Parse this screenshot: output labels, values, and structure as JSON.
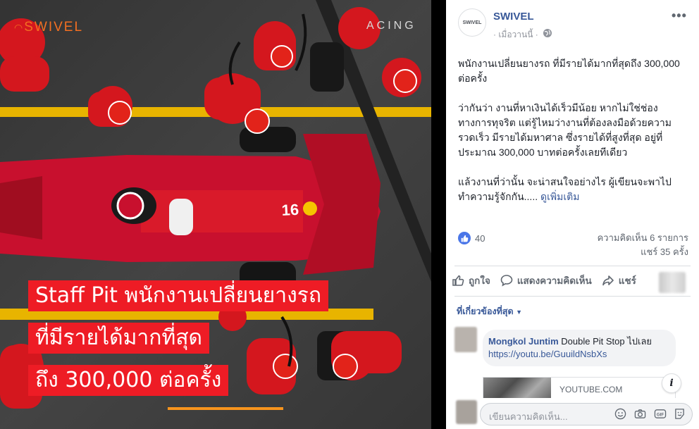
{
  "photo": {
    "brand_logo": "SWIVEL",
    "racing_text": "ACING",
    "car_number": "16",
    "headline": [
      "Staff Pit พนักงานเปลี่ยนยางรถ",
      "ที่มีรายได้มากที่สุด",
      "ถึง 300,000 ต่อครั้ง"
    ]
  },
  "post": {
    "avatar_text": "SWIVEL",
    "page_name": "SWIVEL",
    "time": "· เมื่อวานนี้ ·",
    "more_icon": "more-horizontal-icon",
    "paragraphs": [
      "พนักงานเปลี่ยนยางรถ ที่มีรายได้มากที่สุดถึง 300,000 ต่อครั้ง",
      "ว่ากันว่า งานที่หาเงินได้เร็วมีน้อย หากไม่ใช่ช่องทางการทุจริต แต่รู้ไหมว่างานที่ต้องลงมือด้วยความรวดเร็ว มีรายได้มหาศาล ซึ่งรายได้ที่สูงที่สุด อยู่ที่ประมาณ 300,000 บาทต่อครั้งเลยทีเดียว",
      "แล้วงานที่ว่านั้น จะน่าสนใจอย่างไร ผู้เขียนจะพาไปทำความรู้จักกัน..... "
    ],
    "see_more": "ดูเพิ่มเติม",
    "like_count": "40",
    "comments_count": "ความคิดเห็น 6 รายการ",
    "shares_count": "แชร์ 35 ครั้ง"
  },
  "actions": {
    "like": "ถูกใจ",
    "comment": "แสดงความคิดเห็น",
    "share": "แชร์"
  },
  "comments": {
    "filter_label": "ที่เกี่ยวข้องที่สุด",
    "items": [
      {
        "author": "Mongkol Juntim",
        "text": " Double Pit Stop ไปเลย",
        "link": "https://youtu.be/GuuildNsbXs",
        "preview_domain": "YOUTUBE.COM"
      }
    ],
    "reply_placeholder": "เขียนความคิดเห็น..."
  },
  "colors": {
    "facebook_blue": "#385898",
    "ferrari_red": "#ee1c25",
    "swivel_orange": "#f36f21"
  }
}
